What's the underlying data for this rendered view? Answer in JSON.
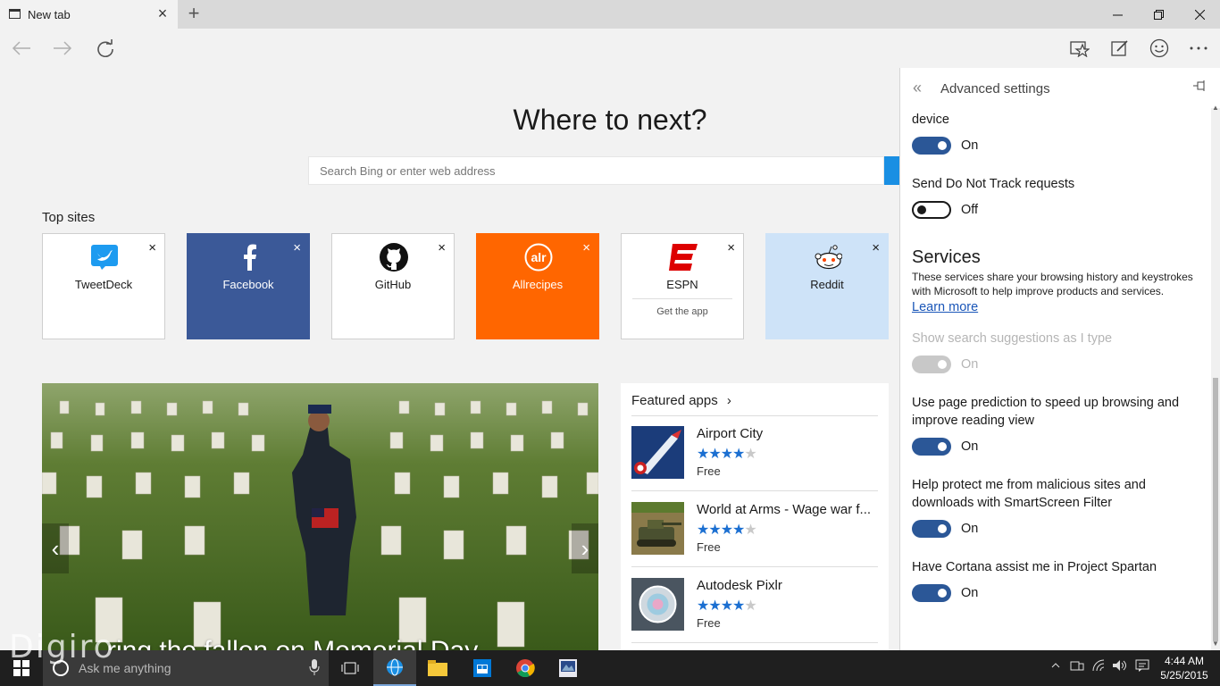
{
  "window": {
    "tab_title": "New tab",
    "tab_close": "×",
    "new_tab": "+"
  },
  "home": {
    "heading": "Where to next?",
    "search_placeholder": "Search Bing or enter web address",
    "top_sites_label": "Top sites",
    "top_sites": [
      {
        "name": "TweetDeck",
        "bg": "#ffffff",
        "fg": "#1a1a1a"
      },
      {
        "name": "Facebook",
        "bg": "#3b5998",
        "fg": "#ffffff"
      },
      {
        "name": "GitHub",
        "bg": "#ffffff",
        "fg": "#1a1a1a"
      },
      {
        "name": "Allrecipes",
        "bg": "#ff6600",
        "fg": "#ffffff"
      },
      {
        "name": "ESPN",
        "bg": "#ffffff",
        "fg": "#1a1a1a",
        "sub": "Get the app"
      },
      {
        "name": "Reddit",
        "bg": "#cee3f8",
        "fg": "#1a1a1a"
      }
    ],
    "close_glyph": "×"
  },
  "news": {
    "headline": "…ring the fallen on Memorial Day",
    "prev_glyph": "‹",
    "next_glyph": "›"
  },
  "featured": {
    "title": "Featured apps",
    "chevron": "›",
    "apps": [
      {
        "name": "Airport City",
        "rating": 4,
        "price": "Free"
      },
      {
        "name": "World at Arms - Wage war f...",
        "rating": 4,
        "price": "Free"
      },
      {
        "name": "Autodesk Pixlr",
        "rating": 4,
        "price": "Free"
      }
    ]
  },
  "settings": {
    "title": "Advanced settings",
    "back_glyph": "«",
    "pin_glyph": "⊣",
    "items": [
      {
        "label": "device",
        "state": "On"
      },
      {
        "label": "Send Do Not Track requests",
        "state": "Off"
      },
      {
        "label": "Show search suggestions as I type",
        "state": "On"
      },
      {
        "label": "Use page prediction to speed up browsing and improve reading view",
        "state": "On"
      },
      {
        "label": "Help protect me from malicious sites and downloads with SmartScreen Filter",
        "state": "On"
      },
      {
        "label": "Have Cortana assist me in Project Spartan",
        "state": "On"
      }
    ],
    "services_title": "Services",
    "services_desc": "These services share your browsing history and keystrokes with Microsoft to help improve products and services.",
    "learn_more": "Learn more"
  },
  "taskbar": {
    "search_placeholder": "Ask me anything",
    "time": "4:44 AM",
    "date": "5/25/2015"
  },
  "watermark": "Digiro",
  "colors": {
    "accent": "#2b5797",
    "edge_blue": "#1a8fe3",
    "star": "#1b6fd1"
  }
}
